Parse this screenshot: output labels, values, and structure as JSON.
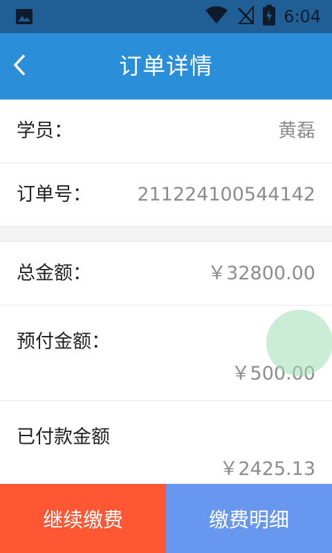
{
  "status_bar": {
    "time": "6:04",
    "icons": [
      "image-icon",
      "wifi-icon",
      "no-signal-icon",
      "battery-charging-icon"
    ]
  },
  "app_bar": {
    "back_icon": "chevron-left-icon",
    "title": "订单详情",
    "color": "#2a8fd8"
  },
  "details": {
    "student_label": "学员：",
    "student_value": "黄磊",
    "order_no_label": "订单号：",
    "order_no_value": "211224100544142",
    "total_label": "总金额：",
    "total_value": "￥32800.00",
    "prepaid_label": "预付金额：",
    "prepaid_value": "￥500.00",
    "paid_label": "已付款金额",
    "paid_value": "￥2425.13"
  },
  "actions": {
    "continue_label": "继续缴费",
    "continue_color": "#ff5733",
    "detail_label": "缴费明细",
    "detail_color": "#6897f0"
  }
}
